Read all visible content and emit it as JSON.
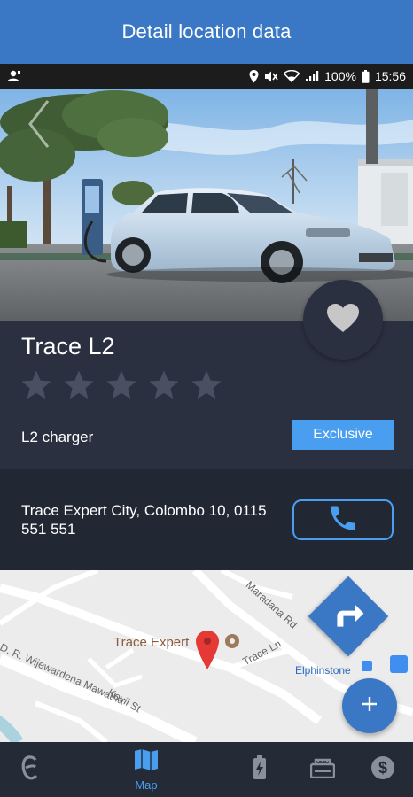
{
  "header": {
    "title": "Detail location data"
  },
  "status_bar": {
    "battery": "100%",
    "time": "15:56"
  },
  "location": {
    "name": "Trace L2",
    "rating": 0,
    "max_rating": 5,
    "charger_type": "L2 charger",
    "badge": "Exclusive",
    "address": "Trace Expert City, Colombo 10, 0115 551 551"
  },
  "map": {
    "poi_name": "Trace Expert",
    "poi_station": "Elphinstone",
    "streets": [
      "Maradana Rd",
      "Trace Ln",
      "D. R. Wijewardena Mawatha",
      "Kovil St"
    ]
  },
  "bottom_nav": {
    "items": [
      {
        "name": "e",
        "label": ""
      },
      {
        "name": "map",
        "label": "Map",
        "active": true
      },
      {
        "name": "battery",
        "label": ""
      },
      {
        "name": "stations",
        "label": ""
      },
      {
        "name": "payments",
        "label": ""
      }
    ]
  },
  "colors": {
    "primary": "#3a78c5",
    "accent": "#4a9ef0",
    "panel": "#2b3040",
    "background": "#222734"
  }
}
